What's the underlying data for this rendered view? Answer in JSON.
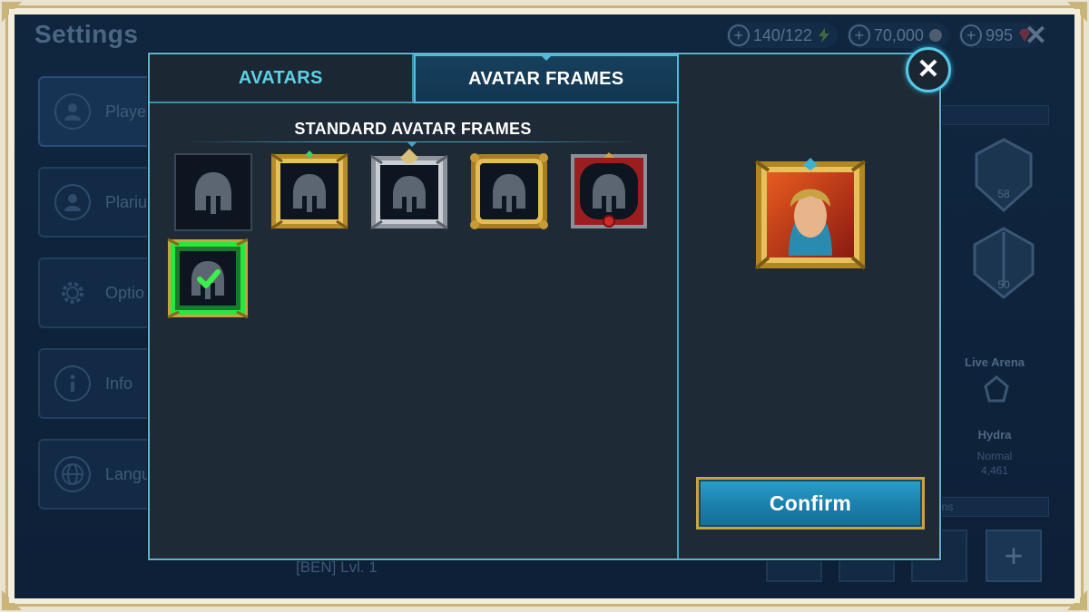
{
  "background": {
    "title": "Settings",
    "resources": [
      {
        "icon": "energy-icon",
        "value": "140/122"
      },
      {
        "icon": "silver-coin-icon",
        "value": "70,000"
      },
      {
        "icon": "gem-icon",
        "value": "995"
      }
    ],
    "side_menu": [
      {
        "label": "Playe",
        "icon": "player-icon"
      },
      {
        "label": "Plariu",
        "icon": "account-icon"
      },
      {
        "label": "Optio",
        "icon": "gear-icon"
      },
      {
        "label": "Info",
        "icon": "info-icon"
      },
      {
        "label": "Langu",
        "icon": "globe-icon"
      }
    ],
    "right_panel": {
      "live_arena": "Live Arena",
      "hydra": "Hydra",
      "hydra_difficulty": "Normal",
      "hydra_score": "4,461",
      "badge_1_level": "58",
      "badge_2_level": "50",
      "field_1_suffix": "s",
      "field_2_suffix": "ons"
    },
    "player_line": "[BEN] Lvl. 1"
  },
  "modal": {
    "tabs": [
      {
        "label": "AVATARS",
        "active": false
      },
      {
        "label": "AVATAR FRAMES",
        "active": true
      }
    ],
    "section_title": "STANDARD AVATAR FRAMES",
    "frames": [
      {
        "name": "frame-none",
        "style": "plain",
        "selected": false
      },
      {
        "name": "frame-gold-gem",
        "style": "gold",
        "selected": false
      },
      {
        "name": "frame-silver-crest",
        "style": "silver",
        "selected": false
      },
      {
        "name": "frame-gold-scroll",
        "style": "gold-ornate",
        "selected": false
      },
      {
        "name": "frame-red-dragon",
        "style": "red",
        "selected": false
      },
      {
        "name": "frame-green-leaf",
        "style": "green",
        "selected": true
      }
    ],
    "confirm_label": "Confirm",
    "close_label": "✕",
    "colors": {
      "accent": "#5cd1e6",
      "selected": "#3cf04a",
      "gold": "#c9a242"
    }
  }
}
